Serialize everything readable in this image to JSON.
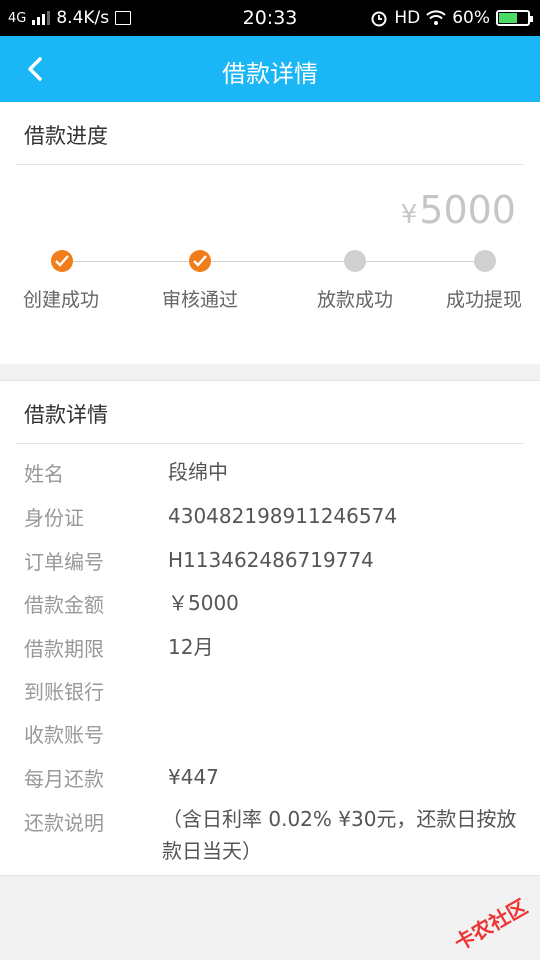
{
  "status_bar": {
    "network": "4G",
    "speed": "8.4K/s",
    "time": "20:33",
    "hd": "HD",
    "battery": "60%",
    "icons": [
      "signal-icon",
      "sim-card-icon",
      "alarm-icon",
      "wifi-icon",
      "battery-icon"
    ]
  },
  "header": {
    "title": "借款详情",
    "back_icon": "chevron-left-icon"
  },
  "progress": {
    "title": "借款进度",
    "currency": "¥",
    "amount": "5000",
    "steps": [
      {
        "label": "创建成功",
        "done": true
      },
      {
        "label": "审核通过",
        "done": true
      },
      {
        "label": "放款成功",
        "done": false
      },
      {
        "label": "成功提现",
        "done": false
      }
    ]
  },
  "details": {
    "title": "借款详情",
    "rows": [
      {
        "label": "姓名",
        "value": "段绵中"
      },
      {
        "label": "身份证",
        "value": "430482198911246574"
      },
      {
        "label": "订单编号",
        "value": "H113462486719774"
      },
      {
        "label": "借款金额",
        "value": "￥5000"
      },
      {
        "label": "借款期限",
        "value": "12月"
      },
      {
        "label": "到账银行",
        "value": ""
      },
      {
        "label": "收款账号",
        "value": ""
      },
      {
        "label": "每月还款",
        "value": "¥447"
      },
      {
        "label": "还款说明",
        "value": "（含日利率 0.02% ¥30元，还款日按放款日当天）"
      }
    ]
  },
  "watermark": "卡农社区",
  "colors": {
    "header": "#1bb6f5",
    "accent": "#f07c1a",
    "inactive": "#d0d0d0"
  }
}
